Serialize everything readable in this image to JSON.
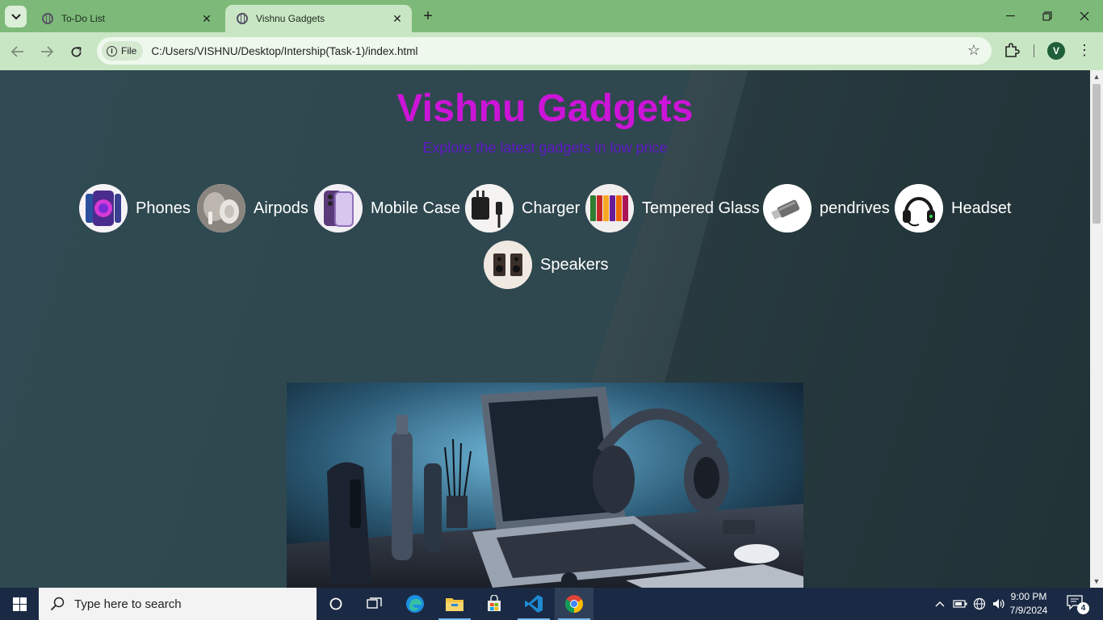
{
  "browser": {
    "tabs": [
      {
        "title": "To-Do List",
        "active": false
      },
      {
        "title": "Vishnu Gadgets",
        "active": true
      }
    ],
    "new_tab_symbol": "+",
    "address": {
      "scheme_chip": "File",
      "url": "C:/Users/VISHNU/Desktop/Intership(Task-1)/index.html"
    },
    "profile_initial": "V",
    "theme_color": "#7dba79"
  },
  "site": {
    "title": "Vishnu Gadgets",
    "subtitle": "Explore the latest gadgets in low price",
    "title_color": "#cc14d8",
    "subtitle_color": "#5d17c6",
    "categories": [
      {
        "label": "Phones",
        "icon": "phone-thumbnail-icon"
      },
      {
        "label": "Airpods",
        "icon": "airpods-thumbnail-icon"
      },
      {
        "label": "Mobile Case",
        "icon": "mobile-case-thumbnail-icon"
      },
      {
        "label": "Charger",
        "icon": "charger-thumbnail-icon"
      },
      {
        "label": "Tempered Glass",
        "icon": "tempered-glass-thumbnail-icon"
      },
      {
        "label": "pendrives",
        "icon": "pendrive-thumbnail-icon"
      },
      {
        "label": "Headset",
        "icon": "headset-thumbnail-icon"
      },
      {
        "label": "Speakers",
        "icon": "speakers-thumbnail-icon"
      }
    ],
    "hero_image": "gadgets-desk-illustration"
  },
  "taskbar": {
    "search_placeholder": "Type here to search",
    "time": "9:00 PM",
    "date": "7/9/2024",
    "notification_count": "4",
    "pinned": [
      "task-view-icon",
      "edge-icon",
      "file-explorer-icon",
      "store-icon",
      "vscode-icon",
      "chrome-icon"
    ]
  }
}
